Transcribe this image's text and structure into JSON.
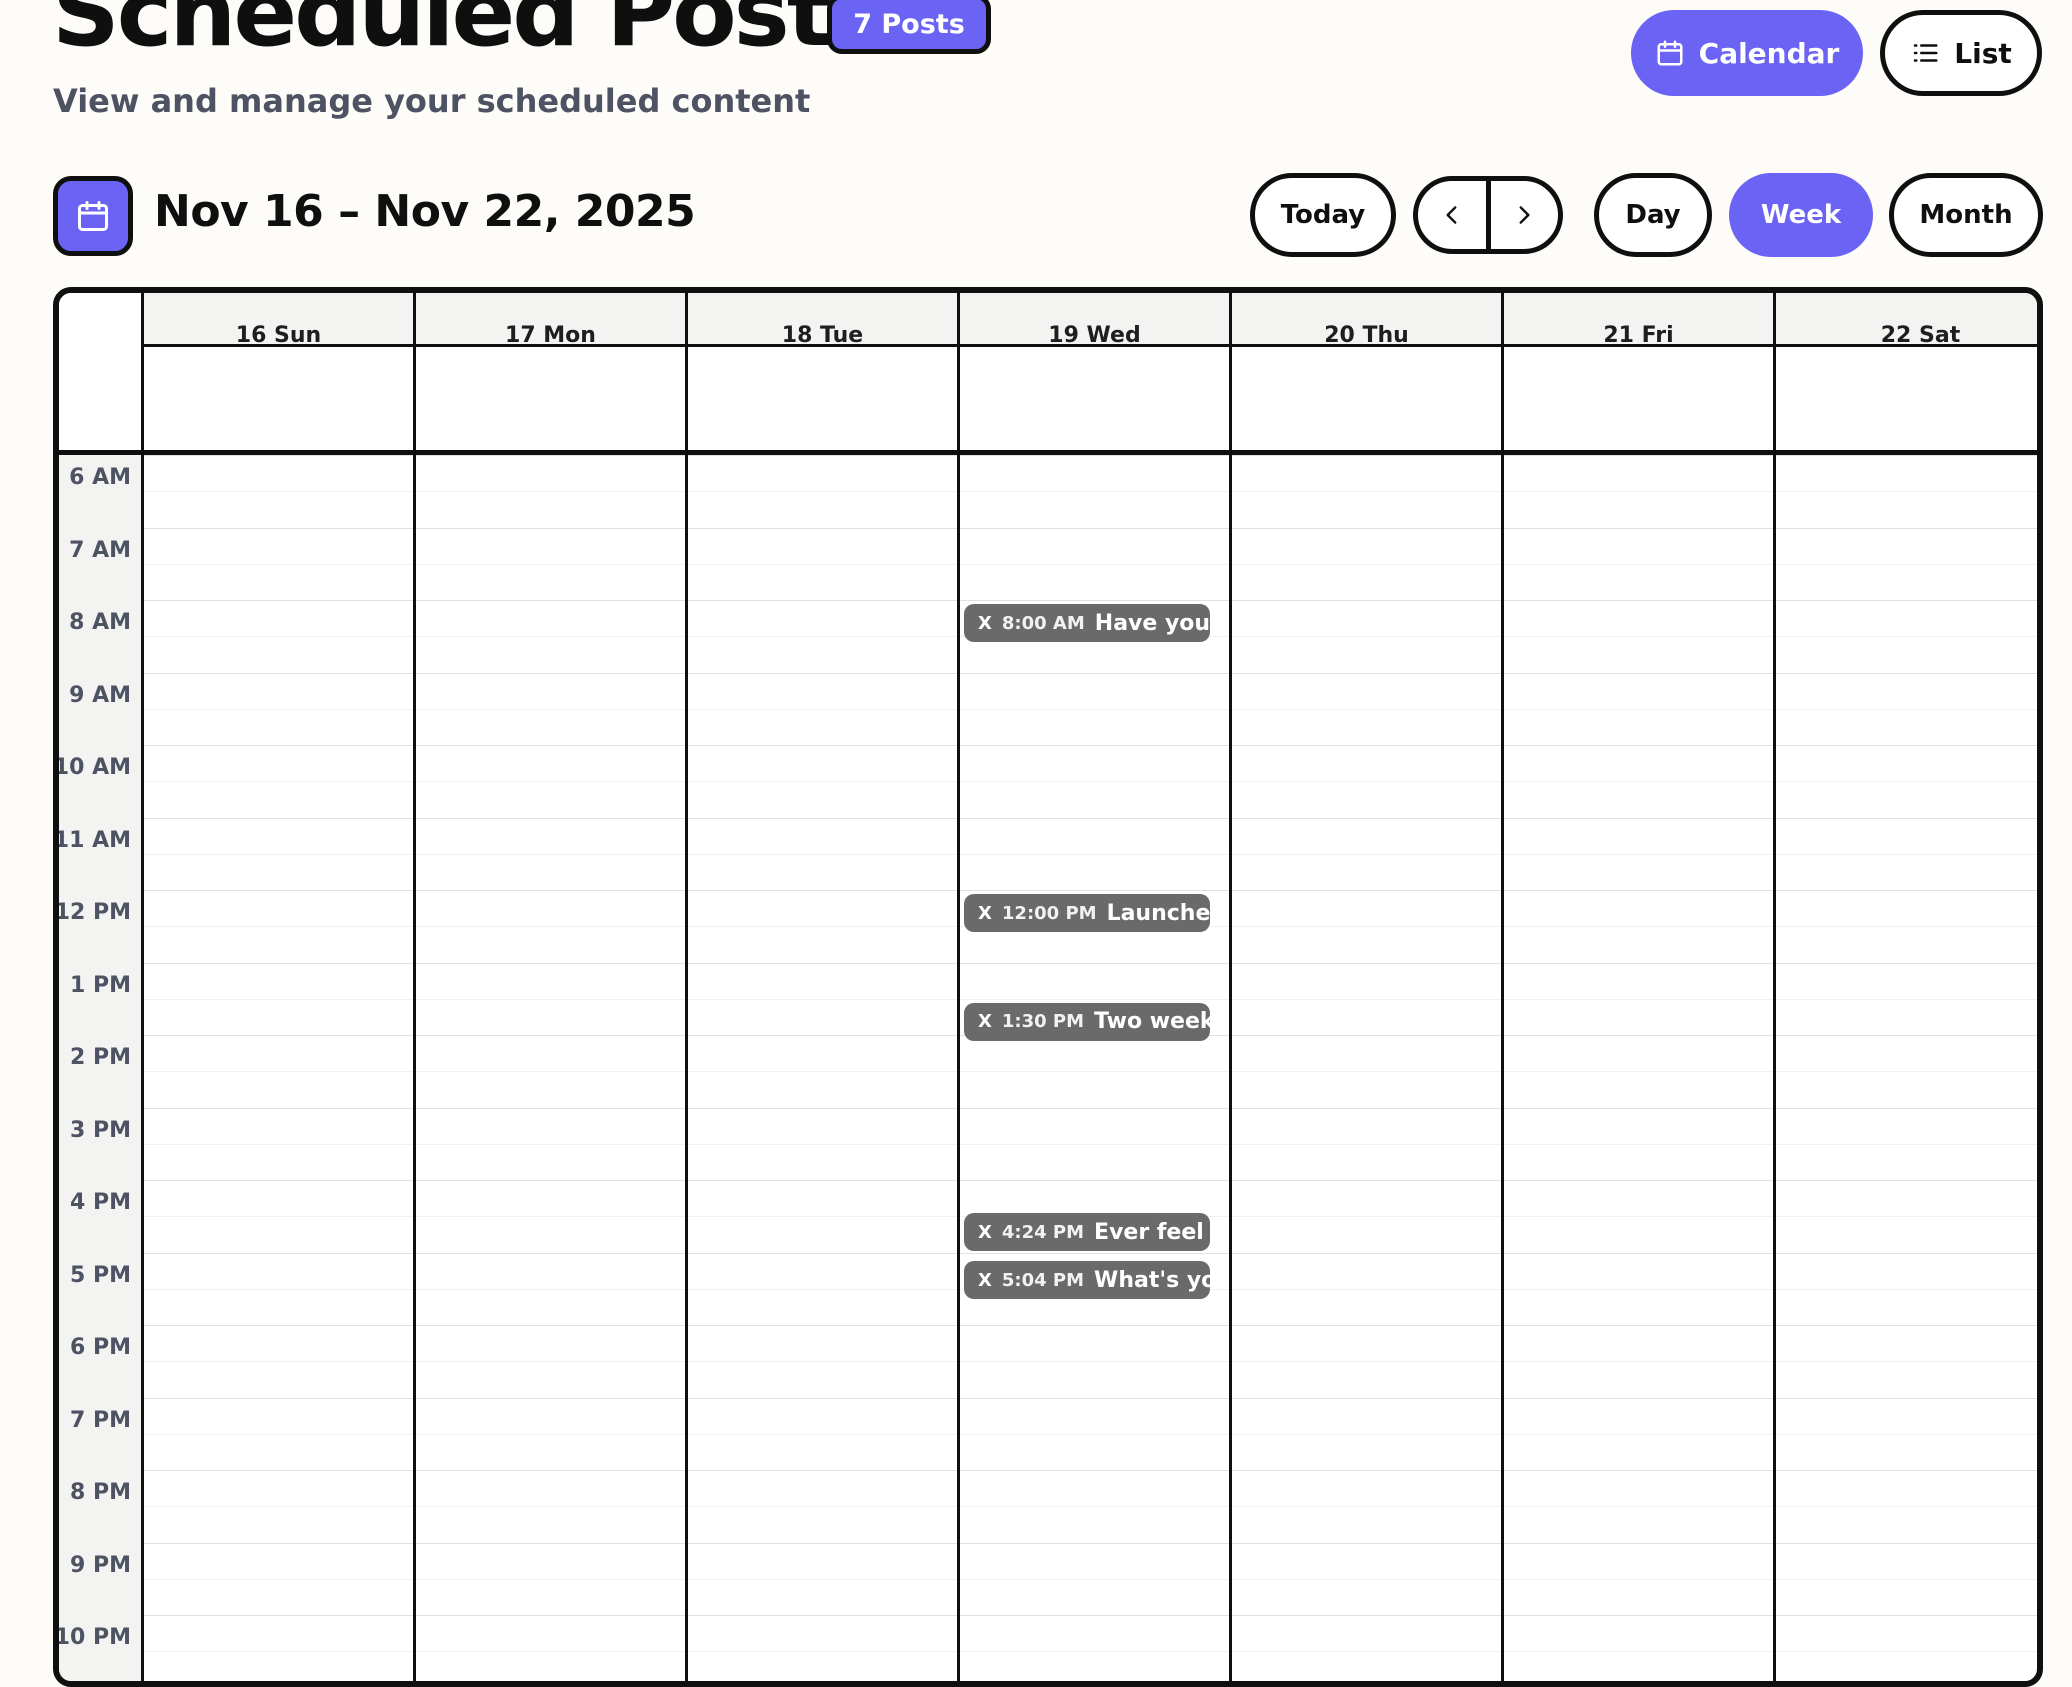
{
  "header": {
    "title": "Scheduled Posts",
    "post_count": "7 Posts",
    "subtitle": "View and manage your scheduled content"
  },
  "view_toggle": {
    "calendar_label": "Calendar",
    "list_label": "List",
    "active": "Calendar"
  },
  "toolbar": {
    "date_range": "Nov 16 – Nov 22, 2025",
    "today_label": "Today",
    "day_label": "Day",
    "week_label": "Week",
    "month_label": "Month",
    "active_view": "Week"
  },
  "calendar": {
    "days": [
      "16 Sun",
      "17 Mon",
      "18 Tue",
      "19 Wed",
      "20 Thu",
      "21 Fri",
      "22 Sat"
    ],
    "hours": [
      "6 AM",
      "7 AM",
      "8 AM",
      "9 AM",
      "10 AM",
      "11 AM",
      "12 PM",
      "1 PM",
      "2 PM",
      "3 PM",
      "4 PM",
      "5 PM",
      "6 PM",
      "7 PM",
      "8 PM",
      "9 PM",
      "10 PM"
    ],
    "events": [
      {
        "day": "19 Wed",
        "platform": "X",
        "time": "8:00 AM",
        "title": "Have you e"
      },
      {
        "day": "19 Wed",
        "platform": "X",
        "time": "12:00 PM",
        "title": "Launched"
      },
      {
        "day": "19 Wed",
        "platform": "X",
        "time": "1:30 PM",
        "title": "Two weeks"
      },
      {
        "day": "19 Wed",
        "platform": "X",
        "time": "4:24 PM",
        "title": "Ever feel lik"
      },
      {
        "day": "19 Wed",
        "platform": "X",
        "time": "5:04 PM",
        "title": "What's you"
      }
    ]
  },
  "colors": {
    "accent": "#6b63f4",
    "event_bg": "#6a6a6a",
    "page_bg": "#fdfcf8",
    "border": "#0f0f0f",
    "muted_text": "#4e5363"
  },
  "icons": {
    "calendar": "calendar-icon",
    "list": "list-icon",
    "prev": "chevron-left-icon",
    "next": "chevron-right-icon",
    "platform": "x-icon"
  }
}
